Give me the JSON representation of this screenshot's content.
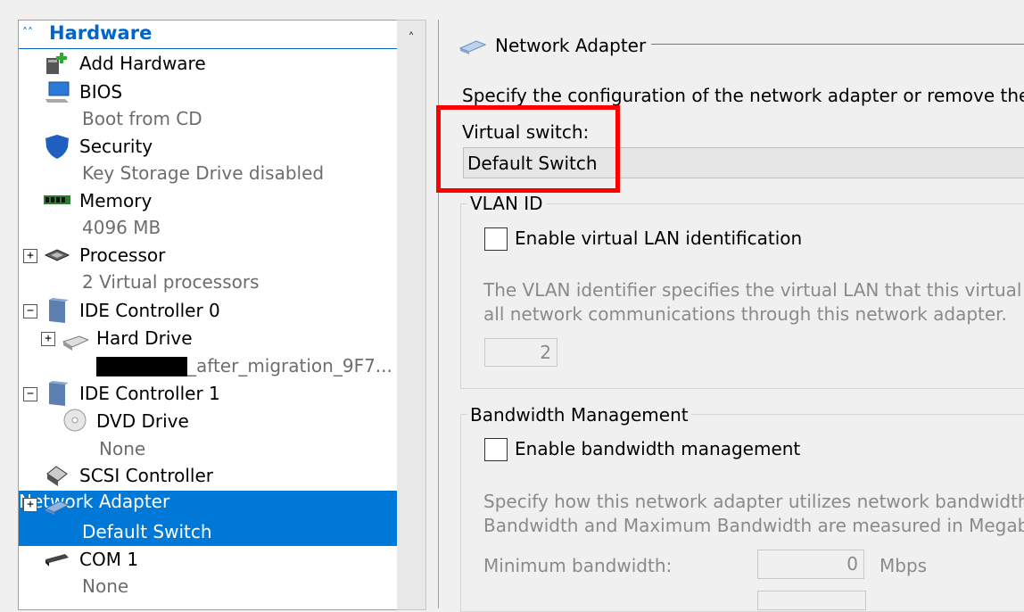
{
  "tree": {
    "header": "Hardware",
    "items": [
      {
        "label": "Add Hardware",
        "icon": "add-hardware-icon"
      },
      {
        "label": "BIOS",
        "sub": "Boot from CD",
        "icon": "bios-icon"
      },
      {
        "label": "Security",
        "sub": "Key Storage Drive disabled",
        "icon": "shield-icon"
      },
      {
        "label": "Memory",
        "sub": "4096 MB",
        "icon": "memory-icon"
      },
      {
        "label": "Processor",
        "sub": "2 Virtual processors",
        "icon": "processor-icon"
      },
      {
        "label": "IDE Controller 0",
        "icon": "ide-controller-icon"
      },
      {
        "label": "Hard Drive",
        "sub": "_after_migration_9F7...",
        "icon": "hard-drive-icon"
      },
      {
        "label": "IDE Controller 1",
        "icon": "ide-controller-icon"
      },
      {
        "label": "DVD Drive",
        "sub": "None",
        "icon": "dvd-drive-icon"
      },
      {
        "label": "SCSI Controller",
        "icon": "scsi-controller-icon"
      },
      {
        "label": "Network Adapter",
        "sub": "Default Switch",
        "icon": "network-adapter-icon"
      },
      {
        "label": "COM 1",
        "sub": "None",
        "icon": "com-port-icon"
      }
    ],
    "selected": "Network Adapter",
    "expander_plus": "+",
    "expander_minus": "−"
  },
  "panel": {
    "title": "Network Adapter",
    "description": "Specify the configuration of the network adapter or remove the n",
    "virtual_switch_label": "Virtual switch:",
    "virtual_switch_value": "Default Switch",
    "vlan": {
      "title": "VLAN ID",
      "checkbox_label": "Enable virtual LAN identification",
      "help_line1": "The VLAN identifier specifies the virtual LAN that this virtual m",
      "help_line2": "all network communications through this network adapter.",
      "value": "2"
    },
    "bandwidth": {
      "title": "Bandwidth Management",
      "checkbox_label": "Enable bandwidth management",
      "help_line1": "Specify how this network adapter utilizes network bandwidth. B",
      "help_line2": "Bandwidth and Maximum Bandwidth are measured in Megabits",
      "min_label": "Minimum bandwidth:",
      "min_value": "0",
      "unit": "Mbps"
    }
  },
  "colors": {
    "selection": "#0078d7",
    "header_text": "#0066cc",
    "highlight_box": "#ff0000"
  }
}
